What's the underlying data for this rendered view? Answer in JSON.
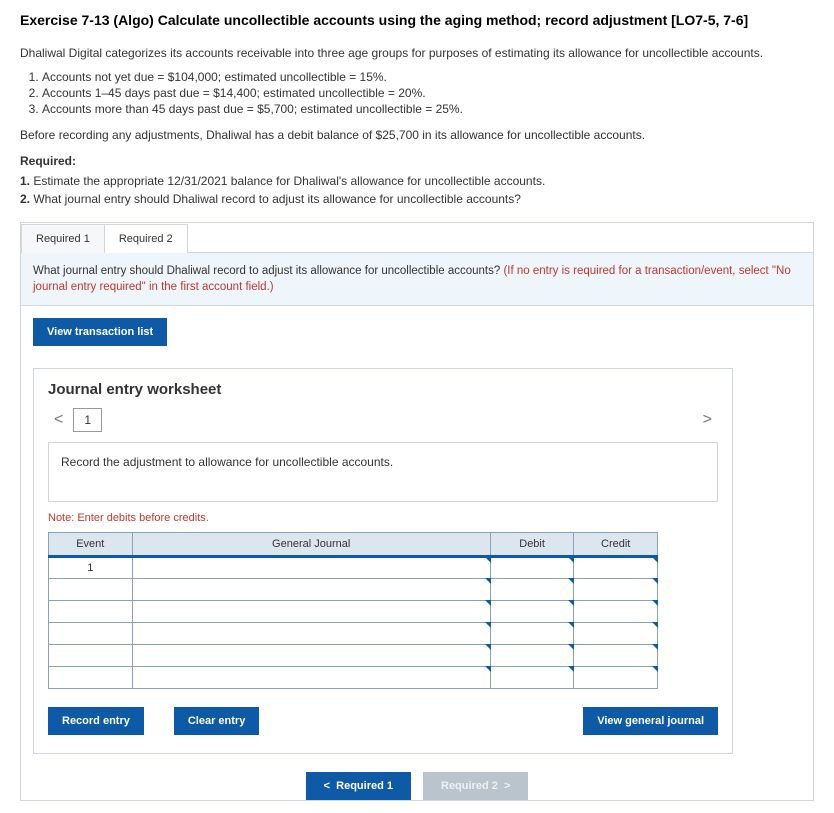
{
  "title": "Exercise 7-13 (Algo) Calculate uncollectible accounts using the aging method; record adjustment [LO7-5, 7-6]",
  "intro": "Dhaliwal Digital categorizes its accounts receivable into three age groups for purposes of estimating its allowance for uncollectible accounts.",
  "list": [
    "Accounts not yet due = $104,000; estimated uncollectible = 15%.",
    "Accounts 1–45 days past due = $14,400; estimated uncollectible = 20%.",
    "Accounts more than 45 days past due = $5,700; estimated uncollectible = 25%."
  ],
  "before": "Before recording any adjustments, Dhaliwal has a debit balance of $25,700 in its allowance for uncollectible accounts.",
  "required_label": "Required:",
  "required": [
    "Estimate the appropriate 12/31/2021 balance for Dhaliwal's allowance for uncollectible accounts.",
    "What journal entry should Dhaliwal record to adjust its allowance for uncollectible accounts?"
  ],
  "tabs": {
    "r1": "Required 1",
    "r2": "Required 2"
  },
  "instruction_main": "What journal entry should Dhaliwal record to adjust its allowance for uncollectible accounts? ",
  "instruction_hint": "(If no entry is required for a transaction/event, select \"No journal entry required\" in the first account field.)",
  "view_trans": "View transaction list",
  "ws_title": "Journal entry worksheet",
  "step": "1",
  "record_instruction": "Record the adjustment to allowance for uncollectible accounts.",
  "note": "Note: Enter debits before credits.",
  "headers": {
    "event": "Event",
    "gj": "General Journal",
    "debit": "Debit",
    "credit": "Credit"
  },
  "event1": "1",
  "buttons": {
    "record": "Record entry",
    "clear": "Clear entry",
    "view_gj": "View general journal",
    "prev": "Required 1",
    "next": "Required 2"
  },
  "chev_left": "<",
  "chev_right": ">"
}
